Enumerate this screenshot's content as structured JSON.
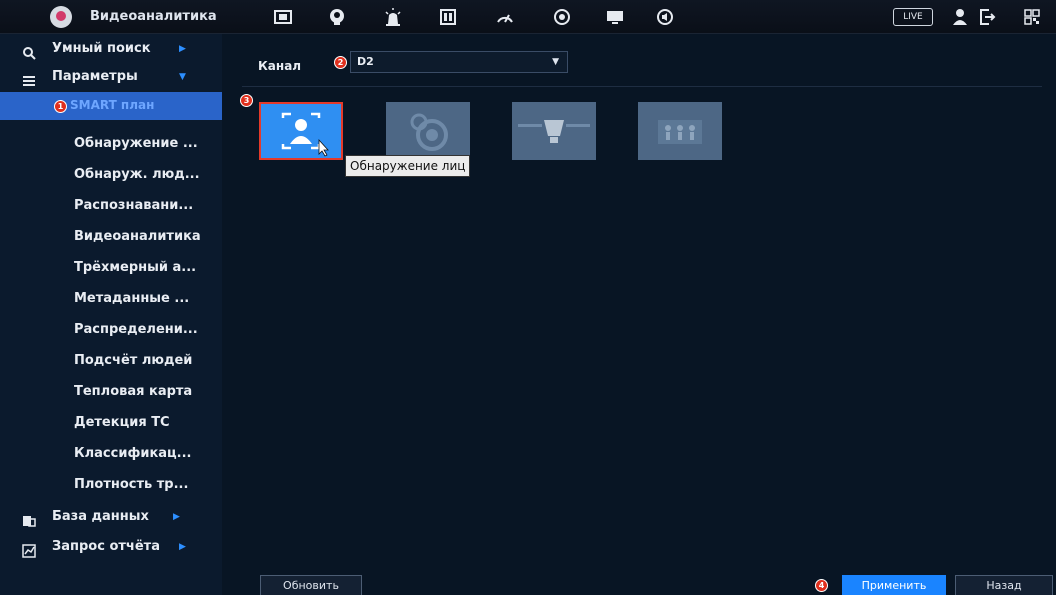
{
  "header": {
    "title": "Видеоаналитика",
    "live_label": "LIVE",
    "icons": [
      "brand-logo-icon",
      "camera-icon",
      "ai-face-icon",
      "alarm-icon",
      "storage-icon",
      "dashboard-gauge-icon",
      "network-icon",
      "display-icon",
      "audio-icon",
      "user-icon",
      "logout-icon",
      "qr-code-icon"
    ]
  },
  "sidebar": {
    "smart_search": "Умный поиск",
    "parameters": "Параметры",
    "smart_plan": "SMART план",
    "subitems": [
      "Обнаружение ...",
      "Обнаруж. люд...",
      "Распознавани...",
      "Видеоаналитика",
      "Трёхмерный а...",
      "Метаданные ...",
      "Распределени...",
      "Подсчёт людей",
      "Тепловая карта",
      "Детекция ТС",
      "Классификац...",
      "Плотность тр..."
    ],
    "database": "База данных",
    "report": "Запрос отчёта"
  },
  "main": {
    "channel_label": "Канал",
    "channel_value": "D2",
    "tooltip": "Обнаружение лиц",
    "refresh": "Обновить",
    "apply": "Применить",
    "back": "Назад"
  },
  "badges": [
    "1",
    "2",
    "3",
    "4"
  ],
  "colors": {
    "accent": "#1a84ff",
    "active_sidebar": "#2a64c9",
    "selected_card": "#2f8ff2",
    "card": "#4d6785",
    "badge": "#e0301e"
  }
}
